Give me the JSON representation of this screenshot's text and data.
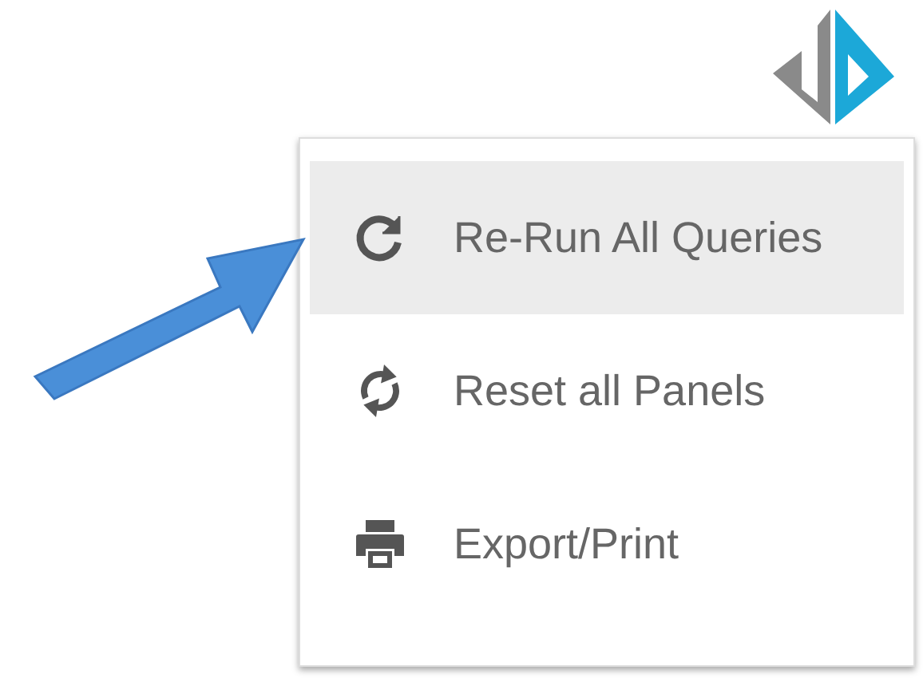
{
  "menu": {
    "items": [
      {
        "kind": "redo",
        "label": "Re-Run All Queries",
        "selected": true
      },
      {
        "kind": "sync",
        "label": "Reset all Panels",
        "selected": false
      },
      {
        "kind": "print",
        "label": "Export/Print",
        "selected": false
      }
    ]
  }
}
